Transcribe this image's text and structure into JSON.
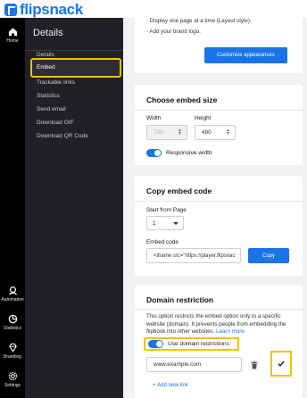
{
  "brand": {
    "name": "flipsnack",
    "color": "#1a73e8"
  },
  "rail": {
    "items": [
      {
        "label": "Home",
        "icon": "home-icon"
      },
      {
        "label": "Automation",
        "icon": "automation-icon"
      },
      {
        "label": "Statistics",
        "icon": "statistics-icon"
      },
      {
        "label": "Branding",
        "icon": "branding-icon"
      },
      {
        "label": "Settings",
        "icon": "settings-icon"
      }
    ]
  },
  "panel": {
    "title": "Details",
    "items": [
      {
        "label": "Details"
      },
      {
        "label": "Embed",
        "active": true
      },
      {
        "label": "Trackable links"
      },
      {
        "label": "Statistics"
      },
      {
        "label": "Send email"
      },
      {
        "label": "Download GIF"
      },
      {
        "label": "Download QR Code"
      }
    ]
  },
  "appearance_card": {
    "bullets": [
      "· Display one page at a time (Layout style).",
      "· Add your brand logo."
    ],
    "button": "Customize appearances"
  },
  "size_card": {
    "title": "Choose embed size",
    "width_label": "Width",
    "width_value": "720",
    "height_label": "Height",
    "height_value": "480",
    "responsive_label": "Responsive width"
  },
  "code_card": {
    "title": "Copy embed code",
    "start_label": "Start from Page",
    "start_value": "1",
    "code_label": "Embed code",
    "code_value": "<iframe src=\"https://player.flipsnac",
    "copy_button": "Copy"
  },
  "domain_card": {
    "title": "Domain restriction",
    "description": "This option restricts the embed option only to a specific website (domain). It prevents people from embedding the flipbook into other websites.",
    "learn_more": "Learn more.",
    "toggle_label": "Use domain restrictions",
    "domain_value": "www.example.com",
    "add_link": "+ Add new link"
  },
  "colors": {
    "accent": "#1a73e8",
    "highlight": "#f2c200",
    "panel": "#202124",
    "rail": "#000000",
    "main_bg": "#f1f2f4"
  }
}
